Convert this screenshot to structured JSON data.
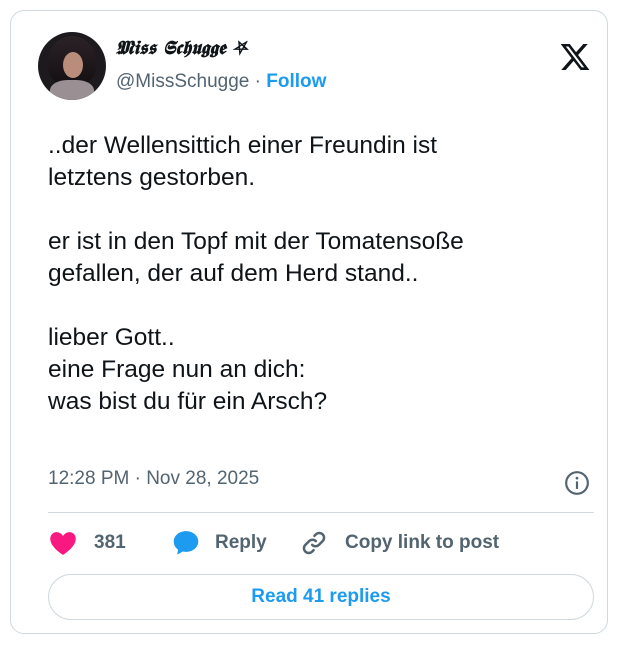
{
  "author": {
    "display_name": "𝕸𝖎𝖘𝖘 𝕾𝖈𝖍𝖚𝖌𝖌𝖊 ⛧",
    "handle": "@MissSchugge",
    "separator": "·",
    "follow_label": "Follow"
  },
  "tweet": {
    "text": "..der Wellensittich einer Freundin ist\nletztens gestorben.\n\ner ist in den Topf mit der Tomatensoße\ngefallen, der auf dem Herd stand..\n\nlieber Gott..\neine Frage nun an dich:\nwas bist du für ein Arsch?",
    "timestamp": "12:28 PM · Nov 28, 2025"
  },
  "actions": {
    "like_count": "381",
    "reply_label": "Reply",
    "copy_link_label": "Copy link to post"
  },
  "footer": {
    "read_replies_label": "Read 41 replies"
  },
  "colors": {
    "accent": "#1d9bf0",
    "like": "#f91880",
    "muted": "#536471",
    "border": "#cfd9de",
    "text": "#0f1419"
  },
  "icons": {
    "logo": "x-logo-icon",
    "info": "info-icon",
    "like": "heart-icon",
    "reply": "speech-bubble-icon",
    "copy": "link-icon"
  }
}
